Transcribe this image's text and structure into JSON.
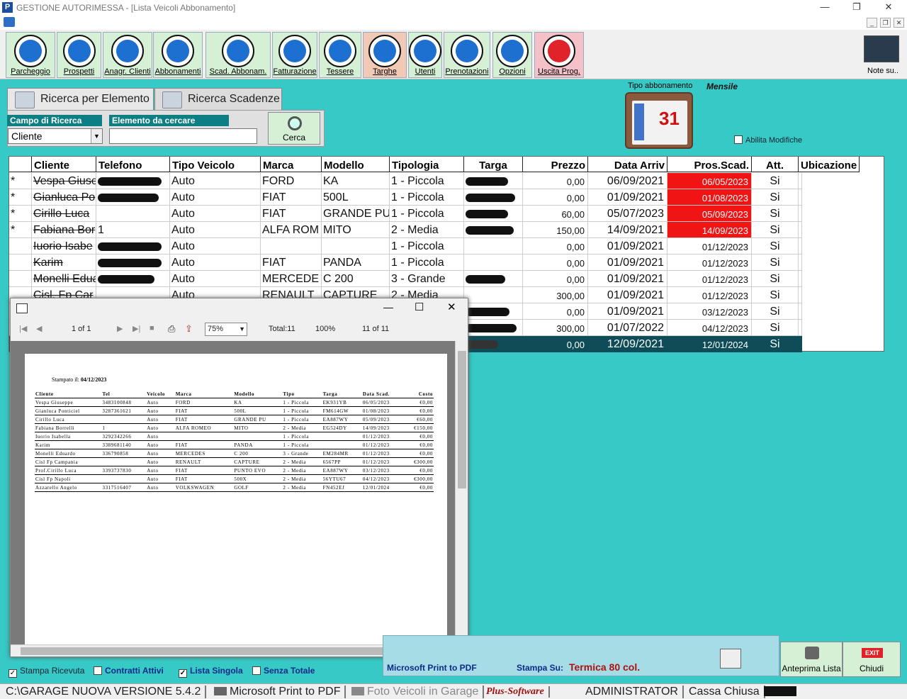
{
  "window": {
    "title": "GESTIONE AUTORIMESSA - [Lista Veicoli Abbonamento]"
  },
  "toolbar": [
    {
      "label": "Parcheggio",
      "icon": "parking-icon"
    },
    {
      "label": "Prospetti",
      "icon": "prospetti-icon"
    },
    {
      "label": "Anagr. Clienti",
      "icon": "clients-icon"
    },
    {
      "label": "Abbonamenti",
      "icon": "subscription-icon"
    },
    {
      "label": "Scad. Abbonam.",
      "icon": "expiry-icon"
    },
    {
      "label": "Fatturazione",
      "icon": "invoice-icon"
    },
    {
      "label": "Tessere",
      "icon": "card-icon"
    },
    {
      "label": "Targhe",
      "icon": "plate-icon"
    },
    {
      "label": "Utenti",
      "icon": "user-icon"
    },
    {
      "label": "Prenotazioni",
      "icon": "booking-icon"
    },
    {
      "label": "Opzioni",
      "icon": "options-icon"
    },
    {
      "label": "Uscita Prog.",
      "icon": "exit-icon"
    }
  ],
  "note_label": "Note su..",
  "tabs": {
    "search": "Ricerca per Elemento",
    "expiry": "Ricerca Scadenze"
  },
  "search": {
    "field_header": "Campo di Ricerca",
    "value_header": "Elemento da cercare",
    "field_value": "Cliente",
    "button": "Cerca"
  },
  "subscription": {
    "label": "Tipo abbonamento",
    "value": "Mensile",
    "calendar_day": "31"
  },
  "abilita_label": "Abilita Modifiche",
  "grid": {
    "columns": [
      "Cliente",
      "Telefono",
      "Tipo Veicolo",
      "Marca",
      "Modello",
      "Tipologia",
      "Targa",
      "Prezzo",
      "Data Arriv",
      "Pros.Scad.",
      "Att.",
      "Ubicazione"
    ],
    "rows": [
      {
        "mark": "*",
        "cliente": "Vespa Giuse",
        "telefono": "",
        "tipo": "Auto",
        "marca": "FORD",
        "modello": "KA",
        "tipologia": "1 - Piccola",
        "prezzo": "0,00",
        "arrivo": "06/09/2021",
        "scad": "06/05/2023",
        "att": "Si",
        "expired": true
      },
      {
        "mark": "*",
        "cliente": "Gianluca Po",
        "telefono": "",
        "tipo": "Auto",
        "marca": "FIAT",
        "modello": "500L",
        "tipologia": "1 - Piccola",
        "prezzo": "0,00",
        "arrivo": "01/09/2021",
        "scad": "01/08/2023",
        "att": "Si",
        "expired": true
      },
      {
        "mark": "*",
        "cliente": "Cirillo Luca",
        "telefono": "",
        "tipo": "Auto",
        "marca": "FIAT",
        "modello": "GRANDE PU",
        "tipologia": "1 - Piccola",
        "prezzo": "60,00",
        "arrivo": "05/07/2023",
        "scad": "05/09/2023",
        "att": "Si",
        "expired": true
      },
      {
        "mark": "*",
        "cliente": "Fabiana Bor",
        "telefono": "1",
        "tipo": "Auto",
        "marca": "ALFA ROM",
        "modello": "MITO",
        "tipologia": "2 - Media",
        "prezzo": "150,00",
        "arrivo": "14/09/2021",
        "scad": "14/09/2023",
        "att": "Si",
        "expired": true
      },
      {
        "mark": "",
        "cliente": "Iuorio Isabe",
        "telefono": "",
        "tipo": "Auto",
        "marca": "",
        "modello": "",
        "tipologia": "1 - Piccola",
        "prezzo": "0,00",
        "arrivo": "01/09/2021",
        "scad": "01/12/2023",
        "att": "Si",
        "expired": false
      },
      {
        "mark": "",
        "cliente": "Karim",
        "telefono": "",
        "tipo": "Auto",
        "marca": "FIAT",
        "modello": "PANDA",
        "tipologia": "1 - Piccola",
        "prezzo": "0,00",
        "arrivo": "01/09/2021",
        "scad": "01/12/2023",
        "att": "Si",
        "expired": false
      },
      {
        "mark": "",
        "cliente": "Monelli Edua",
        "telefono": "",
        "tipo": "Auto",
        "marca": "MERCEDE",
        "modello": "C 200",
        "tipologia": "3 - Grande",
        "prezzo": "0,00",
        "arrivo": "01/09/2021",
        "scad": "01/12/2023",
        "att": "Si",
        "expired": false
      },
      {
        "mark": "",
        "cliente": "Cisl. Fp Car",
        "telefono": "",
        "tipo": "Auto",
        "marca": "RENAULT",
        "modello": "CAPTURE",
        "tipologia": "2 - Media",
        "prezzo": "300,00",
        "arrivo": "01/09/2021",
        "scad": "01/12/2023",
        "att": "Si",
        "expired": false
      },
      {
        "mark": "",
        "cliente": "",
        "telefono": "",
        "tipo": "",
        "marca": "",
        "modello": "",
        "tipologia": "",
        "prezzo": "0,00",
        "arrivo": "01/09/2021",
        "scad": "03/12/2023",
        "att": "Si",
        "expired": false
      },
      {
        "mark": "",
        "cliente": "",
        "telefono": "",
        "tipo": "",
        "marca": "",
        "modello": "",
        "tipologia": "",
        "prezzo": "300,00",
        "arrivo": "01/07/2022",
        "scad": "04/12/2023",
        "att": "Si",
        "expired": false
      },
      {
        "mark": "",
        "cliente": "",
        "telefono": "",
        "tipo": "",
        "marca": "",
        "modello": "",
        "tipologia": "",
        "prezzo": "0,00",
        "arrivo": "12/09/2021",
        "scad": "12/01/2024",
        "att": "Si",
        "expired": false,
        "selected": true
      }
    ]
  },
  "preview": {
    "page": "1 of 1",
    "zoom": "75%",
    "total": "Total:11",
    "percent": "100%",
    "count": "11 of 11",
    "stamp_label": "Stampato il:",
    "stamp_date": "04/12/2023",
    "headers": [
      "Cliente",
      "Tel",
      "Veicolo",
      "Marca",
      "Modello",
      "Tipo",
      "Targa",
      "Data Scad.",
      "Costo"
    ],
    "rows": [
      [
        "Vespa Giuseppe",
        "3483100848",
        "Auto",
        "FORD",
        "KA",
        "1 - Piccola",
        "EK931YB",
        "06/05/2023",
        "€0,00"
      ],
      [
        "Gianluca Ponticiel",
        "3287361621",
        "Auto",
        "FIAT",
        "500L",
        "1 - Piccola",
        "FM614GW",
        "01/08/2023",
        "€0,00"
      ],
      [
        "Cirillo Luca",
        "",
        "Auto",
        "FIAT",
        "GRANDE PU",
        "1 - Piccola",
        "EA887WY",
        "05/09/2023",
        "€60,00"
      ],
      [
        "Fabiana Borrelli",
        "1",
        "Auto",
        "ALFA ROMEO",
        "MITO",
        "2 - Media",
        "EG524DY",
        "14/09/2023",
        "€150,00"
      ],
      [
        "Iuorio Isabella",
        "3292342266",
        "Auto",
        "",
        "",
        "1 - Piccola",
        "",
        "01/12/2023",
        "€0,00"
      ],
      [
        "Karim",
        "3389681140",
        "Auto",
        "FIAT",
        "PANDA",
        "1 - Piccola",
        "",
        "01/12/2023",
        "€0,00"
      ],
      [
        "Monelli Eduardo",
        "336790858",
        "Auto",
        "MERCEDES",
        "C 200",
        "3 - Grande",
        "EM284MR",
        "01/12/2023",
        "€0,00"
      ],
      [
        "Cisl  Fp Campania",
        "",
        "Auto",
        "RENAULT",
        "CAPTURE",
        "2 - Media",
        "6567PP",
        "01/12/2023",
        "€300,00"
      ],
      [
        "Prof.Cirillo Luca",
        "3393737830",
        "Auto",
        "FIAT",
        "PUNTO EVO",
        "2 - Media",
        "EA887WY",
        "03/12/2023",
        "€0,00"
      ],
      [
        "Cisl Fp Napoli",
        "",
        "Auto",
        "FIAT",
        "500X",
        "2 - Media",
        "56YTU67",
        "04/12/2023",
        "€300,00"
      ],
      [
        "Azzarello Angelo",
        "3317516407",
        "Auto",
        "VOLKSWAGEN",
        "GOLF",
        "2 - Media",
        "FN452EJ",
        "12/01/2024",
        "€0,00"
      ]
    ]
  },
  "options": [
    {
      "label": "Stampa Ricevuta",
      "checked": true
    },
    {
      "label": "Contratti Attivi",
      "checked": false
    },
    {
      "label": "Lista Singola",
      "checked": true
    },
    {
      "label": "Senza Totale",
      "checked": false
    }
  ],
  "print": {
    "printer": "Microsoft Print to PDF",
    "stampa_label": "Stampa Su:",
    "stampa_value": "Termica 80 col."
  },
  "buttons": {
    "anteprima": "Anteprima Lista",
    "chiudi": "Chiudi",
    "exit_badge": "EXIT"
  },
  "status": [
    "C:\\GARAGE NUOVA VERSIONE 5.4.2",
    "Microsoft Print to PDF",
    "Foto Veicoli in Garage",
    "Plus-Software",
    "ADMINISTRATOR",
    "Cassa Chiusa"
  ]
}
